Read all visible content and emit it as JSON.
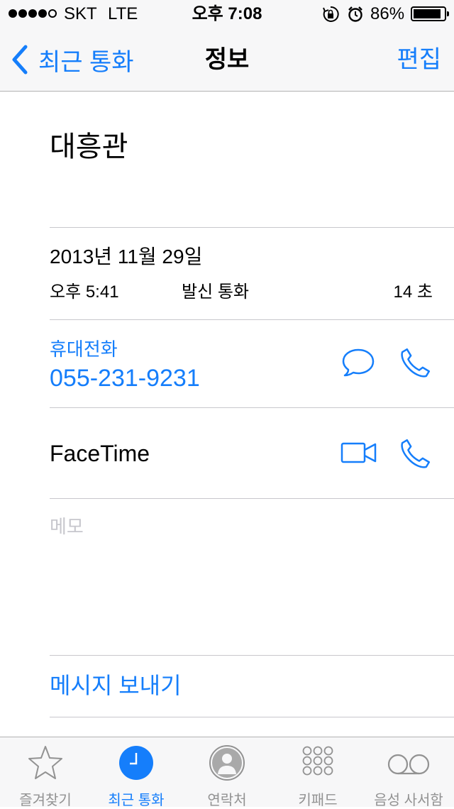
{
  "status_bar": {
    "carrier": "SKT",
    "network": "LTE",
    "time": "오후 7:08",
    "battery": "86%"
  },
  "nav": {
    "back_label": "최근 통화",
    "title": "정보",
    "edit_label": "편집"
  },
  "contact": {
    "name": "대흥관"
  },
  "call": {
    "date": "2013년 11월 29일",
    "time": "오후 5:41",
    "type": "발신 통화",
    "duration": "14 초"
  },
  "phone": {
    "label": "휴대전화",
    "number": "055-231-9231"
  },
  "facetime": {
    "label": "FaceTime"
  },
  "note": {
    "placeholder": "메모"
  },
  "send_message": {
    "label": "메시지 보내기"
  },
  "tabs": [
    {
      "label": "즐겨찾기",
      "icon": "star-icon",
      "active": false
    },
    {
      "label": "최근 통화",
      "icon": "clock-icon",
      "active": true
    },
    {
      "label": "연락처",
      "icon": "contact-icon",
      "active": false
    },
    {
      "label": "키패드",
      "icon": "keypad-icon",
      "active": false
    },
    {
      "label": "음성 사서함",
      "icon": "voicemail-icon",
      "active": false
    }
  ],
  "colors": {
    "accent": "#157efb",
    "separator": "#c8c7cc",
    "bar": "#f7f7f8",
    "tab_inactive": "#929292"
  }
}
